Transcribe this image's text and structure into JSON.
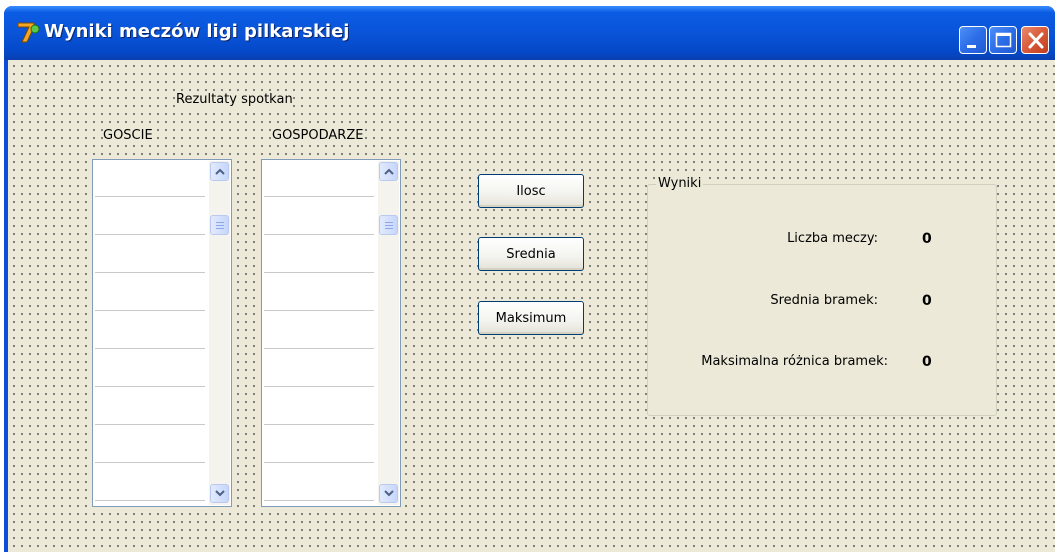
{
  "window": {
    "title": "Wyniki meczów ligi pilkarskiej",
    "icon": "app-icon",
    "controls": [
      "minimize-icon",
      "maximize-icon",
      "close-icon"
    ]
  },
  "form": {
    "heading": "Rezultaty spotkan",
    "guests_label": "GOSCIE",
    "hosts_label": "GOSPODARZE"
  },
  "buttons": {
    "count": "Ilosc",
    "average": "Srednia",
    "maximum": "Maksimum"
  },
  "results": {
    "group_title": "Wyniki",
    "match_count_label": "Liczba meczy:",
    "match_count_value": "0",
    "avg_goals_label": "Srednia bramek:",
    "avg_goals_value": "0",
    "max_diff_label": "Maksimalna różnica bramek:",
    "max_diff_value": "0"
  },
  "colors": {
    "titlebar": "#0a54d8",
    "client_bg": "#ece9d8",
    "button_border": "#003c74"
  }
}
